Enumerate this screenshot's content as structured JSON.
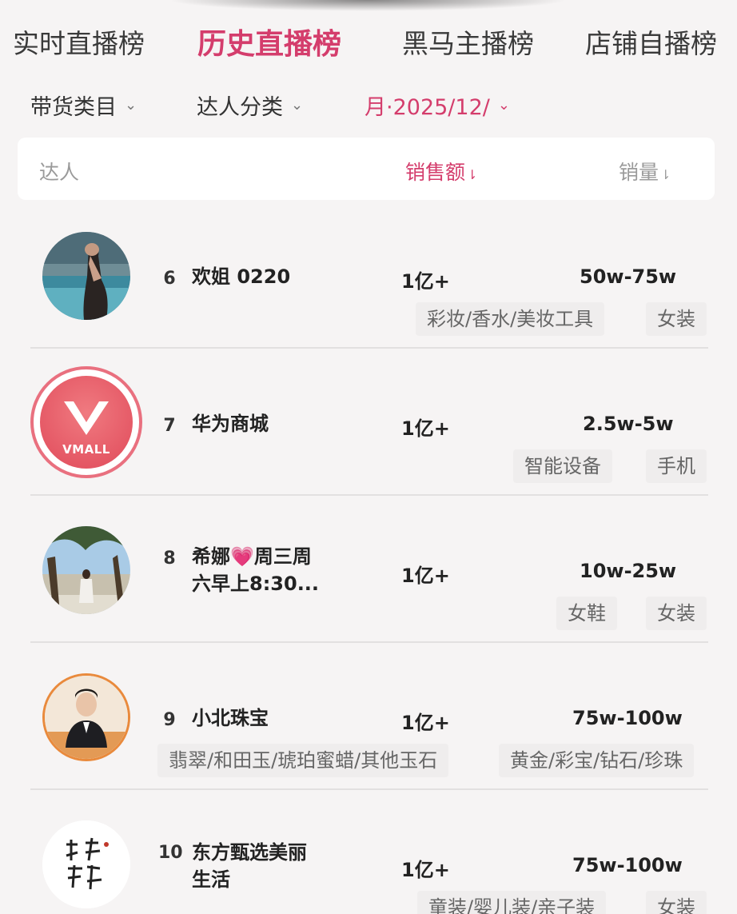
{
  "tabs": [
    {
      "label": "实时直播榜",
      "active": false
    },
    {
      "label": "历史直播榜",
      "active": true
    },
    {
      "label": "黑马主播榜",
      "active": false
    },
    {
      "label": "店铺自播榜",
      "active": false
    }
  ],
  "filters": {
    "category": "带货类目",
    "talent_type": "达人分类",
    "period": "月·2025/12/"
  },
  "table_header": {
    "talent": "达人",
    "sales": "销售额",
    "volume": "销量"
  },
  "rows": [
    {
      "rank": "6",
      "name": "欢姐 0220",
      "name_line2": "",
      "sales": "1亿+",
      "volume": "50w-75w",
      "tags": [
        "彩妆/香水/美妆工具",
        "女装"
      ]
    },
    {
      "rank": "7",
      "name": "华为商城",
      "name_line2": "",
      "sales": "1亿+",
      "volume": "2.5w-5w",
      "tags": [
        "智能设备",
        "手机"
      ],
      "logo_text": "VMALL"
    },
    {
      "rank": "8",
      "name": "希娜💗周三周",
      "name_line2": "六早上8:30...",
      "sales": "1亿+",
      "volume": "10w-25w",
      "tags": [
        "女鞋",
        "女装"
      ]
    },
    {
      "rank": "9",
      "name": "小北珠宝",
      "name_line2": "",
      "sales": "1亿+",
      "volume": "75w-100w",
      "tags": [
        "翡翠/和田玉/琥珀蜜蜡/其他玉石",
        "黄金/彩宝/钻石/珍珠"
      ]
    },
    {
      "rank": "10",
      "name": "东方甄选美丽",
      "name_line2": "生活",
      "sales": "1亿+",
      "volume": "75w-100w",
      "tags": [
        "童装/婴儿装/亲子装",
        "女装"
      ]
    }
  ],
  "colors": {
    "accent": "#d43d6c",
    "tag_bg": "#efeded"
  }
}
